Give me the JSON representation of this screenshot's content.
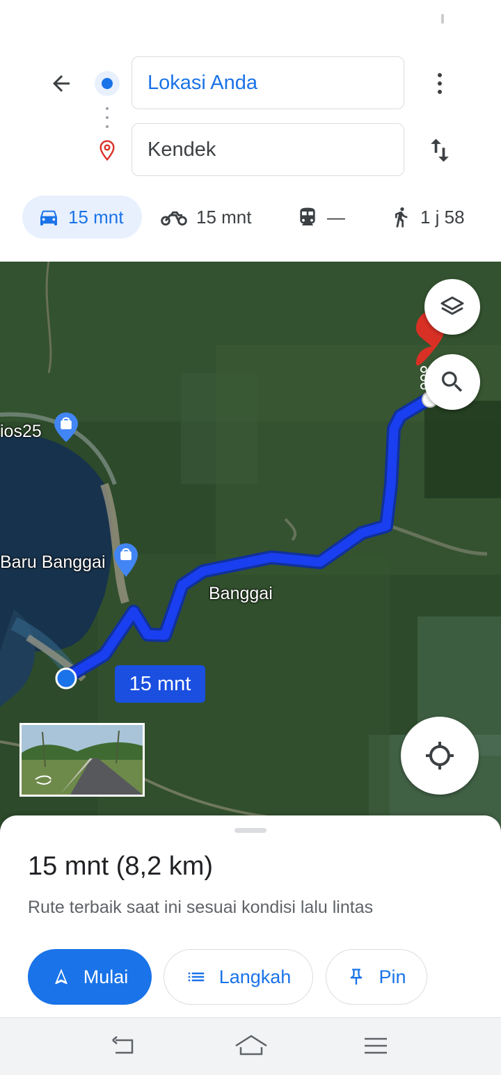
{
  "directions": {
    "origin_value": "Lokasi Anda",
    "destination_value": "Kendek"
  },
  "modes": [
    {
      "name": "car",
      "label": "15 mnt",
      "active": true
    },
    {
      "name": "motorcycle",
      "label": "15 mnt",
      "active": false
    },
    {
      "name": "transit",
      "label": "—",
      "active": false
    },
    {
      "name": "walk",
      "label": "1 j 58",
      "active": false
    }
  ],
  "map": {
    "labels": {
      "place_1": "ios25",
      "place_2": "Baru Banggai",
      "town": "Banggai"
    },
    "route_badge": "15 mnt"
  },
  "sheet": {
    "duration": "15 mnt (8,2 km)",
    "description": "Rute terbaik saat ini sesuai kondisi lalu lintas",
    "buttons": {
      "start": "Mulai",
      "steps": "Langkah",
      "pin": "Pin"
    }
  },
  "colors": {
    "accent": "#1a73e8",
    "route": "#1a3ff0",
    "destination_pin": "#d93025",
    "mode_active_bg": "#e8f0fe"
  },
  "icons": {
    "back": "arrow-left-icon",
    "more": "more-vert-icon",
    "swap": "swap-vert-icon",
    "layers": "layers-icon",
    "search": "search-icon",
    "location": "my-location-icon",
    "start": "navigation-arrow-icon",
    "steps": "list-icon",
    "pin": "pushpin-icon"
  }
}
